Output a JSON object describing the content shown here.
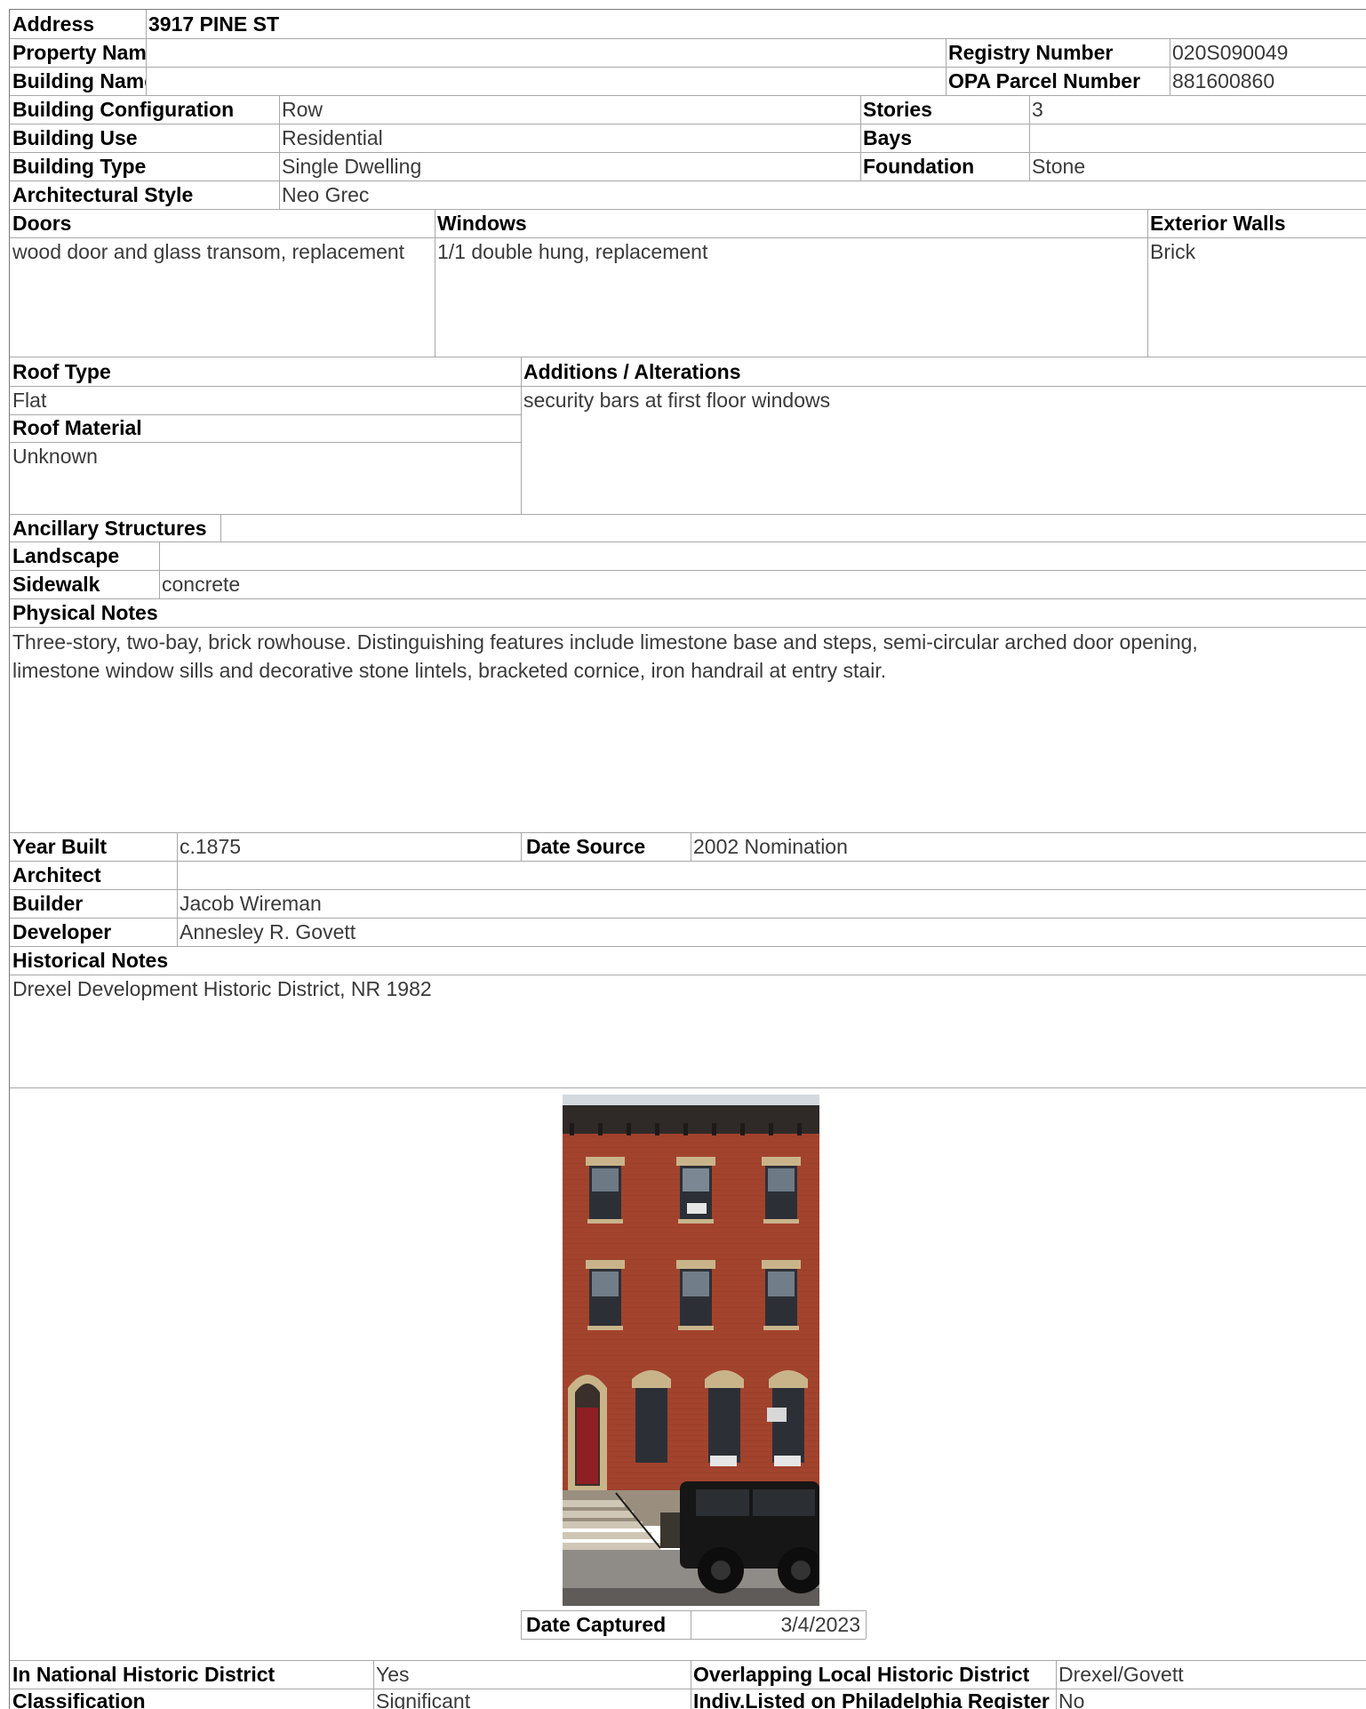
{
  "address": {
    "label": "Address",
    "value": "3917 PINE ST"
  },
  "property_name": {
    "label": "Property Name",
    "value": ""
  },
  "building_name": {
    "label": "Building Name",
    "value": ""
  },
  "registry_number": {
    "label": "Registry Number",
    "value": "020S090049"
  },
  "opa_parcel_number": {
    "label": "OPA Parcel Number",
    "value": "881600860"
  },
  "building_configuration": {
    "label": "Building Configuration",
    "value": "Row"
  },
  "stories": {
    "label": "Stories",
    "value": "3"
  },
  "building_use": {
    "label": "Building Use",
    "value": "Residential"
  },
  "bays": {
    "label": "Bays",
    "value": ""
  },
  "building_type": {
    "label": "Building Type",
    "value": "Single Dwelling"
  },
  "foundation": {
    "label": "Foundation",
    "value": "Stone"
  },
  "architectural_style": {
    "label": "Architectural Style",
    "value": "Neo Grec"
  },
  "doors": {
    "label": "Doors",
    "value": "wood door and glass transom, replacement"
  },
  "windows": {
    "label": "Windows",
    "value": "1/1 double hung, replacement"
  },
  "exterior_walls": {
    "label": "Exterior Walls",
    "value": "Brick"
  },
  "roof_type": {
    "label": "Roof Type",
    "value": "Flat"
  },
  "roof_material": {
    "label": "Roof Material",
    "value": "Unknown"
  },
  "additions_alterations": {
    "label": "Additions / Alterations",
    "value": "security bars at first floor windows"
  },
  "ancillary_structures": {
    "label": "Ancillary Structures",
    "value": ""
  },
  "landscape": {
    "label": "Landscape",
    "value": ""
  },
  "sidewalk": {
    "label": "Sidewalk",
    "value": "concrete"
  },
  "physical_notes": {
    "label": "Physical Notes",
    "value": "Three-story, two-bay, brick rowhouse. Distinguishing features include limestone base and steps, semi-circular arched door opening, limestone window sills and decorative stone lintels, bracketed cornice, iron handrail at entry stair."
  },
  "year_built": {
    "label": "Year Built",
    "value": "c.1875"
  },
  "date_source": {
    "label": "Date Source",
    "value": "2002 Nomination"
  },
  "architect": {
    "label": "Architect",
    "value": ""
  },
  "builder": {
    "label": "Builder",
    "value": "Jacob Wireman"
  },
  "developer": {
    "label": "Developer",
    "value": "Annesley R. Govett"
  },
  "historical_notes": {
    "label": "Historical Notes",
    "value": "Drexel Development Historic District, NR 1982"
  },
  "date_captured": {
    "label": "Date Captured",
    "value": "3/4/2023"
  },
  "national_historic_district": {
    "label": "In National Historic District",
    "value": "Yes"
  },
  "overlapping_local_district": {
    "label": "Overlapping Local Historic District",
    "value": "Drexel/Govett"
  },
  "classification": {
    "label": "Classification",
    "value": "Significant"
  },
  "indiv_listed": {
    "label": "Indiv.Listed on Philadelphia Register",
    "value": "No"
  },
  "colors": {
    "brick": "#a2432d",
    "door": "#8e1f24",
    "limestone": "#c9b48a",
    "cornice": "#2f2a28"
  }
}
